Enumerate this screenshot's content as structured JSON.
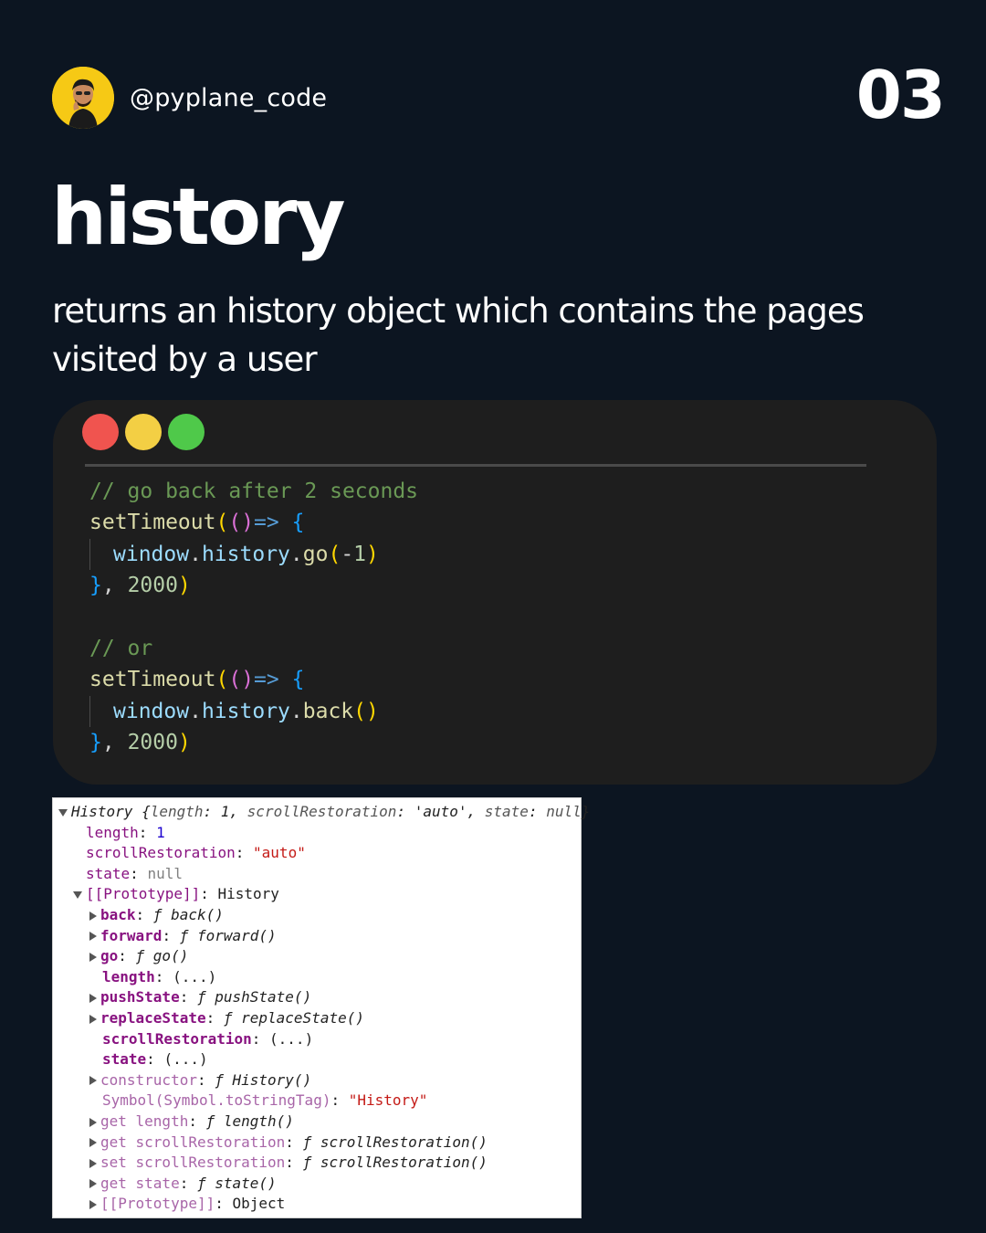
{
  "header": {
    "handle": "@pyplane_code",
    "page_number": "03",
    "avatar_icon": "person-avatar-icon"
  },
  "title": "history",
  "subtitle": "returns an history object which contains the pages visited by a user",
  "code_window": {
    "dot_colors": [
      "#f0544f",
      "#f3cf44",
      "#4fc94a"
    ],
    "lines": [
      [
        {
          "t": "// go back after 2 seconds",
          "c": "c-comment"
        }
      ],
      [
        {
          "t": "setTimeout",
          "c": "c-fn"
        },
        {
          "t": "(",
          "c": "c-brace1"
        },
        {
          "t": "()",
          "c": "c-brace2"
        },
        {
          "t": "=>",
          "c": "c-kw"
        },
        {
          "t": " ",
          "c": "c-plain"
        },
        {
          "t": "{",
          "c": "c-brace3"
        }
      ],
      [
        {
          "t": "INDENT",
          "c": "indent"
        },
        {
          "t": "window",
          "c": "c-var"
        },
        {
          "t": ".",
          "c": "c-plain"
        },
        {
          "t": "history",
          "c": "c-var"
        },
        {
          "t": ".",
          "c": "c-plain"
        },
        {
          "t": "go",
          "c": "c-fn"
        },
        {
          "t": "(",
          "c": "c-brace1"
        },
        {
          "t": "-",
          "c": "c-plain"
        },
        {
          "t": "1",
          "c": "c-num"
        },
        {
          "t": ")",
          "c": "c-brace1"
        }
      ],
      [
        {
          "t": "}",
          "c": "c-brace3"
        },
        {
          "t": ", ",
          "c": "c-plain"
        },
        {
          "t": "2000",
          "c": "c-num"
        },
        {
          "t": ")",
          "c": "c-brace1"
        }
      ],
      [
        {
          "t": "",
          "c": "c-plain"
        }
      ],
      [
        {
          "t": "// or",
          "c": "c-comment"
        }
      ],
      [
        {
          "t": "setTimeout",
          "c": "c-fn"
        },
        {
          "t": "(",
          "c": "c-brace1"
        },
        {
          "t": "()",
          "c": "c-brace2"
        },
        {
          "t": "=>",
          "c": "c-kw"
        },
        {
          "t": " ",
          "c": "c-plain"
        },
        {
          "t": "{",
          "c": "c-brace3"
        }
      ],
      [
        {
          "t": "INDENT",
          "c": "indent"
        },
        {
          "t": "window",
          "c": "c-var"
        },
        {
          "t": ".",
          "c": "c-plain"
        },
        {
          "t": "history",
          "c": "c-var"
        },
        {
          "t": ".",
          "c": "c-plain"
        },
        {
          "t": "back",
          "c": "c-fn"
        },
        {
          "t": "()",
          "c": "c-brace1"
        }
      ],
      [
        {
          "t": "}",
          "c": "c-brace3"
        },
        {
          "t": ", ",
          "c": "c-plain"
        },
        {
          "t": "2000",
          "c": "c-num"
        },
        {
          "t": ")",
          "c": "c-brace1"
        }
      ]
    ]
  },
  "devtools": {
    "rows": [
      {
        "indent": 0,
        "tri": "down",
        "parts": [
          {
            "t": "History {",
            "c": "k-it"
          },
          {
            "t": "length",
            "c": "k-italic-grey"
          },
          {
            "t": ": ",
            "c": "k-it"
          },
          {
            "t": "1",
            "c": "k-it"
          },
          {
            "t": ", ",
            "c": "k-it"
          },
          {
            "t": "scrollRestoration",
            "c": "k-italic-grey"
          },
          {
            "t": ": ",
            "c": "k-it"
          },
          {
            "t": "'auto'",
            "c": "k-str k-it"
          },
          {
            "t": ", ",
            "c": "k-it"
          },
          {
            "t": "state",
            "c": "k-italic-grey"
          },
          {
            "t": ": ",
            "c": "k-it"
          },
          {
            "t": "null",
            "c": "k-italic-grey"
          },
          {
            "t": "}",
            "c": "k-it"
          }
        ]
      },
      {
        "indent": 1,
        "tri": "none",
        "parts": [
          {
            "t": "length",
            "c": "k-purple"
          },
          {
            "t": ": ",
            "c": "k-dark"
          },
          {
            "t": "1",
            "c": "k-num"
          }
        ]
      },
      {
        "indent": 1,
        "tri": "none",
        "parts": [
          {
            "t": "scrollRestoration",
            "c": "k-purple"
          },
          {
            "t": ": ",
            "c": "k-dark"
          },
          {
            "t": "\"auto\"",
            "c": "k-str"
          }
        ]
      },
      {
        "indent": 1,
        "tri": "none",
        "parts": [
          {
            "t": "state",
            "c": "k-purple"
          },
          {
            "t": ": ",
            "c": "k-dark"
          },
          {
            "t": "null",
            "c": "k-null"
          }
        ]
      },
      {
        "indent": 1,
        "tri": "down",
        "parts": [
          {
            "t": "[[Prototype]]",
            "c": "k-purple"
          },
          {
            "t": ": History",
            "c": "k-dark"
          }
        ]
      },
      {
        "indent": 2,
        "tri": "right",
        "parts": [
          {
            "t": "back",
            "c": "k-purple-b"
          },
          {
            "t": ": ",
            "c": "k-dark"
          },
          {
            "t": "ƒ back()",
            "c": "k-it"
          }
        ]
      },
      {
        "indent": 2,
        "tri": "right",
        "parts": [
          {
            "t": "forward",
            "c": "k-purple-b"
          },
          {
            "t": ": ",
            "c": "k-dark"
          },
          {
            "t": "ƒ forward()",
            "c": "k-it"
          }
        ]
      },
      {
        "indent": 2,
        "tri": "right",
        "parts": [
          {
            "t": "go",
            "c": "k-purple-b"
          },
          {
            "t": ": ",
            "c": "k-dark"
          },
          {
            "t": "ƒ go()",
            "c": "k-it"
          }
        ]
      },
      {
        "indent": 2,
        "tri": "none",
        "parts": [
          {
            "t": "length",
            "c": "k-purple-b"
          },
          {
            "t": ": (...)",
            "c": "k-dark"
          }
        ]
      },
      {
        "indent": 2,
        "tri": "right",
        "parts": [
          {
            "t": "pushState",
            "c": "k-purple-b"
          },
          {
            "t": ": ",
            "c": "k-dark"
          },
          {
            "t": "ƒ pushState()",
            "c": "k-it"
          }
        ]
      },
      {
        "indent": 2,
        "tri": "right",
        "parts": [
          {
            "t": "replaceState",
            "c": "k-purple-b"
          },
          {
            "t": ": ",
            "c": "k-dark"
          },
          {
            "t": "ƒ replaceState()",
            "c": "k-it"
          }
        ]
      },
      {
        "indent": 2,
        "tri": "none",
        "parts": [
          {
            "t": "scrollRestoration",
            "c": "k-purple-b"
          },
          {
            "t": ": (...)",
            "c": "k-dark"
          }
        ]
      },
      {
        "indent": 2,
        "tri": "none",
        "parts": [
          {
            "t": "state",
            "c": "k-purple-b"
          },
          {
            "t": ": (...)",
            "c": "k-dark"
          }
        ]
      },
      {
        "indent": 2,
        "tri": "right",
        "parts": [
          {
            "t": "constructor",
            "c": "k-faded"
          },
          {
            "t": ": ",
            "c": "k-dark"
          },
          {
            "t": "ƒ History()",
            "c": "k-it"
          }
        ]
      },
      {
        "indent": 2,
        "tri": "none",
        "parts": [
          {
            "t": "Symbol(Symbol.toStringTag)",
            "c": "k-faded"
          },
          {
            "t": ": ",
            "c": "k-dark"
          },
          {
            "t": "\"History\"",
            "c": "k-str"
          }
        ]
      },
      {
        "indent": 2,
        "tri": "right",
        "parts": [
          {
            "t": "get length",
            "c": "k-faded"
          },
          {
            "t": ": ",
            "c": "k-dark"
          },
          {
            "t": "ƒ length()",
            "c": "k-it"
          }
        ]
      },
      {
        "indent": 2,
        "tri": "right",
        "parts": [
          {
            "t": "get scrollRestoration",
            "c": "k-faded"
          },
          {
            "t": ": ",
            "c": "k-dark"
          },
          {
            "t": "ƒ scrollRestoration()",
            "c": "k-it"
          }
        ]
      },
      {
        "indent": 2,
        "tri": "right",
        "parts": [
          {
            "t": "set scrollRestoration",
            "c": "k-faded"
          },
          {
            "t": ": ",
            "c": "k-dark"
          },
          {
            "t": "ƒ scrollRestoration()",
            "c": "k-it"
          }
        ]
      },
      {
        "indent": 2,
        "tri": "right",
        "parts": [
          {
            "t": "get state",
            "c": "k-faded"
          },
          {
            "t": ": ",
            "c": "k-dark"
          },
          {
            "t": "ƒ state()",
            "c": "k-it"
          }
        ]
      },
      {
        "indent": 2,
        "tri": "right",
        "parts": [
          {
            "t": "[[Prototype]]",
            "c": "k-faded"
          },
          {
            "t": ": Object",
            "c": "k-dark"
          }
        ]
      }
    ]
  }
}
